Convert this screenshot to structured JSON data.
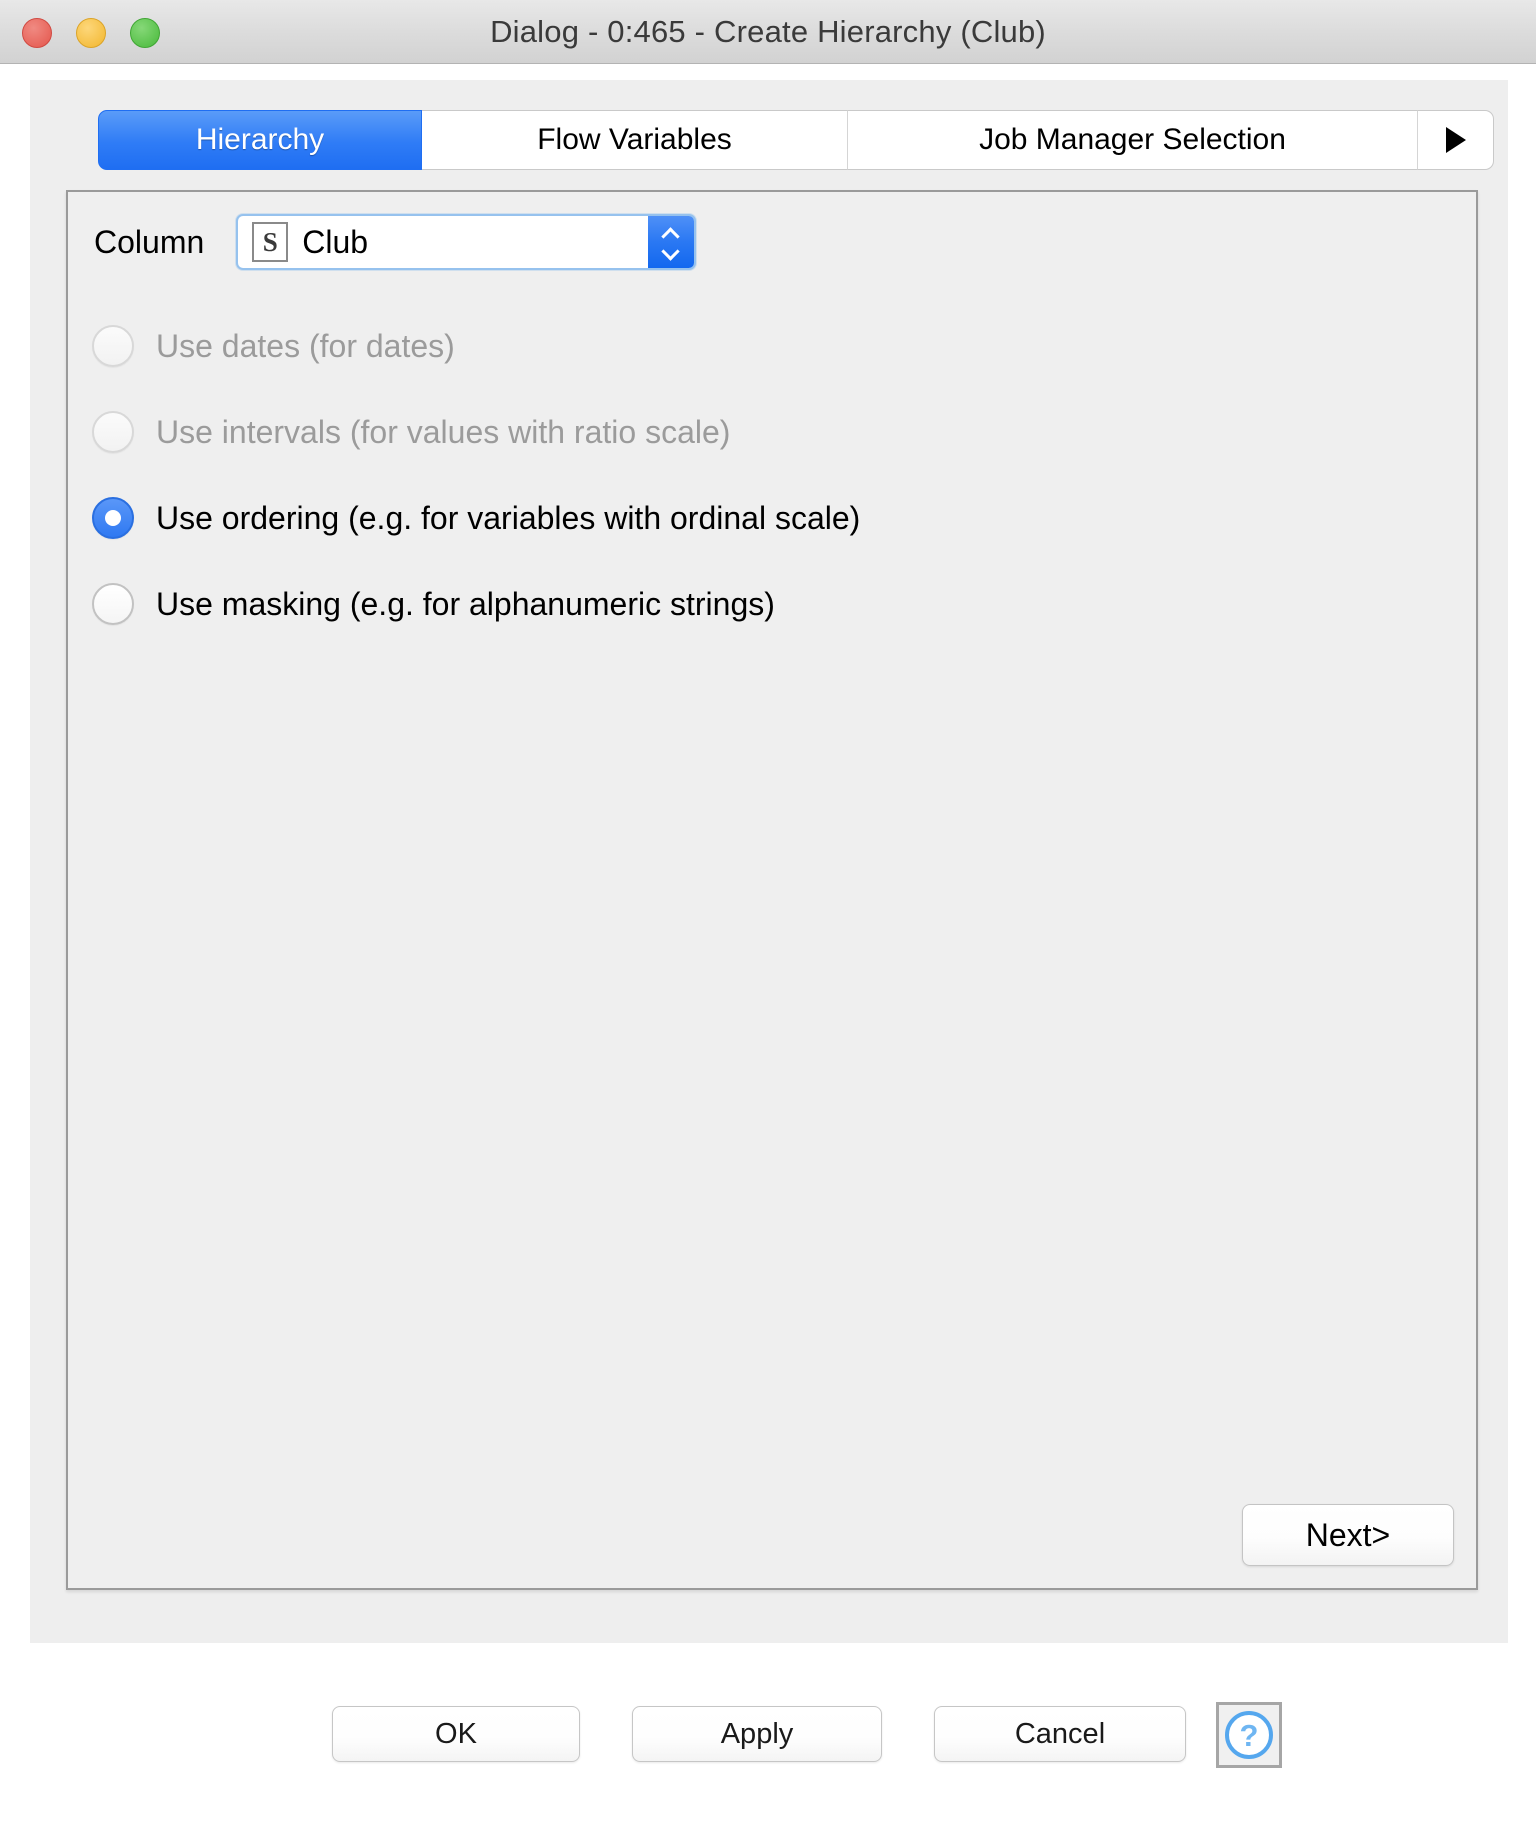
{
  "window": {
    "title": "Dialog - 0:465 - Create Hierarchy (Club)",
    "controls": {
      "close": "close-button",
      "minimize": "minimize-button",
      "maximize": "maximize-button"
    }
  },
  "tabs": [
    {
      "label": "Hierarchy",
      "active": true
    },
    {
      "label": "Flow Variables",
      "active": false
    },
    {
      "label": "Job Manager Selection",
      "active": false
    },
    {
      "label": "▶",
      "active": false
    }
  ],
  "form": {
    "column_label": "Column",
    "column_value": "Club",
    "column_type_icon": "S",
    "options": [
      {
        "label": "Use dates (for dates)",
        "selected": false,
        "disabled": true
      },
      {
        "label": "Use intervals (for values with ratio scale)",
        "selected": false,
        "disabled": true
      },
      {
        "label": "Use ordering (e.g. for variables with ordinal scale)",
        "selected": true,
        "disabled": false
      },
      {
        "label": "Use masking (e.g. for alphanumeric strings)",
        "selected": false,
        "disabled": false
      }
    ],
    "next_label": "Next>"
  },
  "footer": {
    "ok_label": "OK",
    "apply_label": "Apply",
    "cancel_label": "Cancel",
    "help_label": "?"
  },
  "colors": {
    "accent_blue": "#2f7cf6",
    "radio_blue": "#3d7ff5",
    "help_blue": "#6fb6f2",
    "panel_gray": "#eeeeee",
    "content_gray": "#efefef",
    "traffic_red": "#e4564c",
    "traffic_yellow": "#f2b62e",
    "traffic_green": "#48b93a"
  }
}
